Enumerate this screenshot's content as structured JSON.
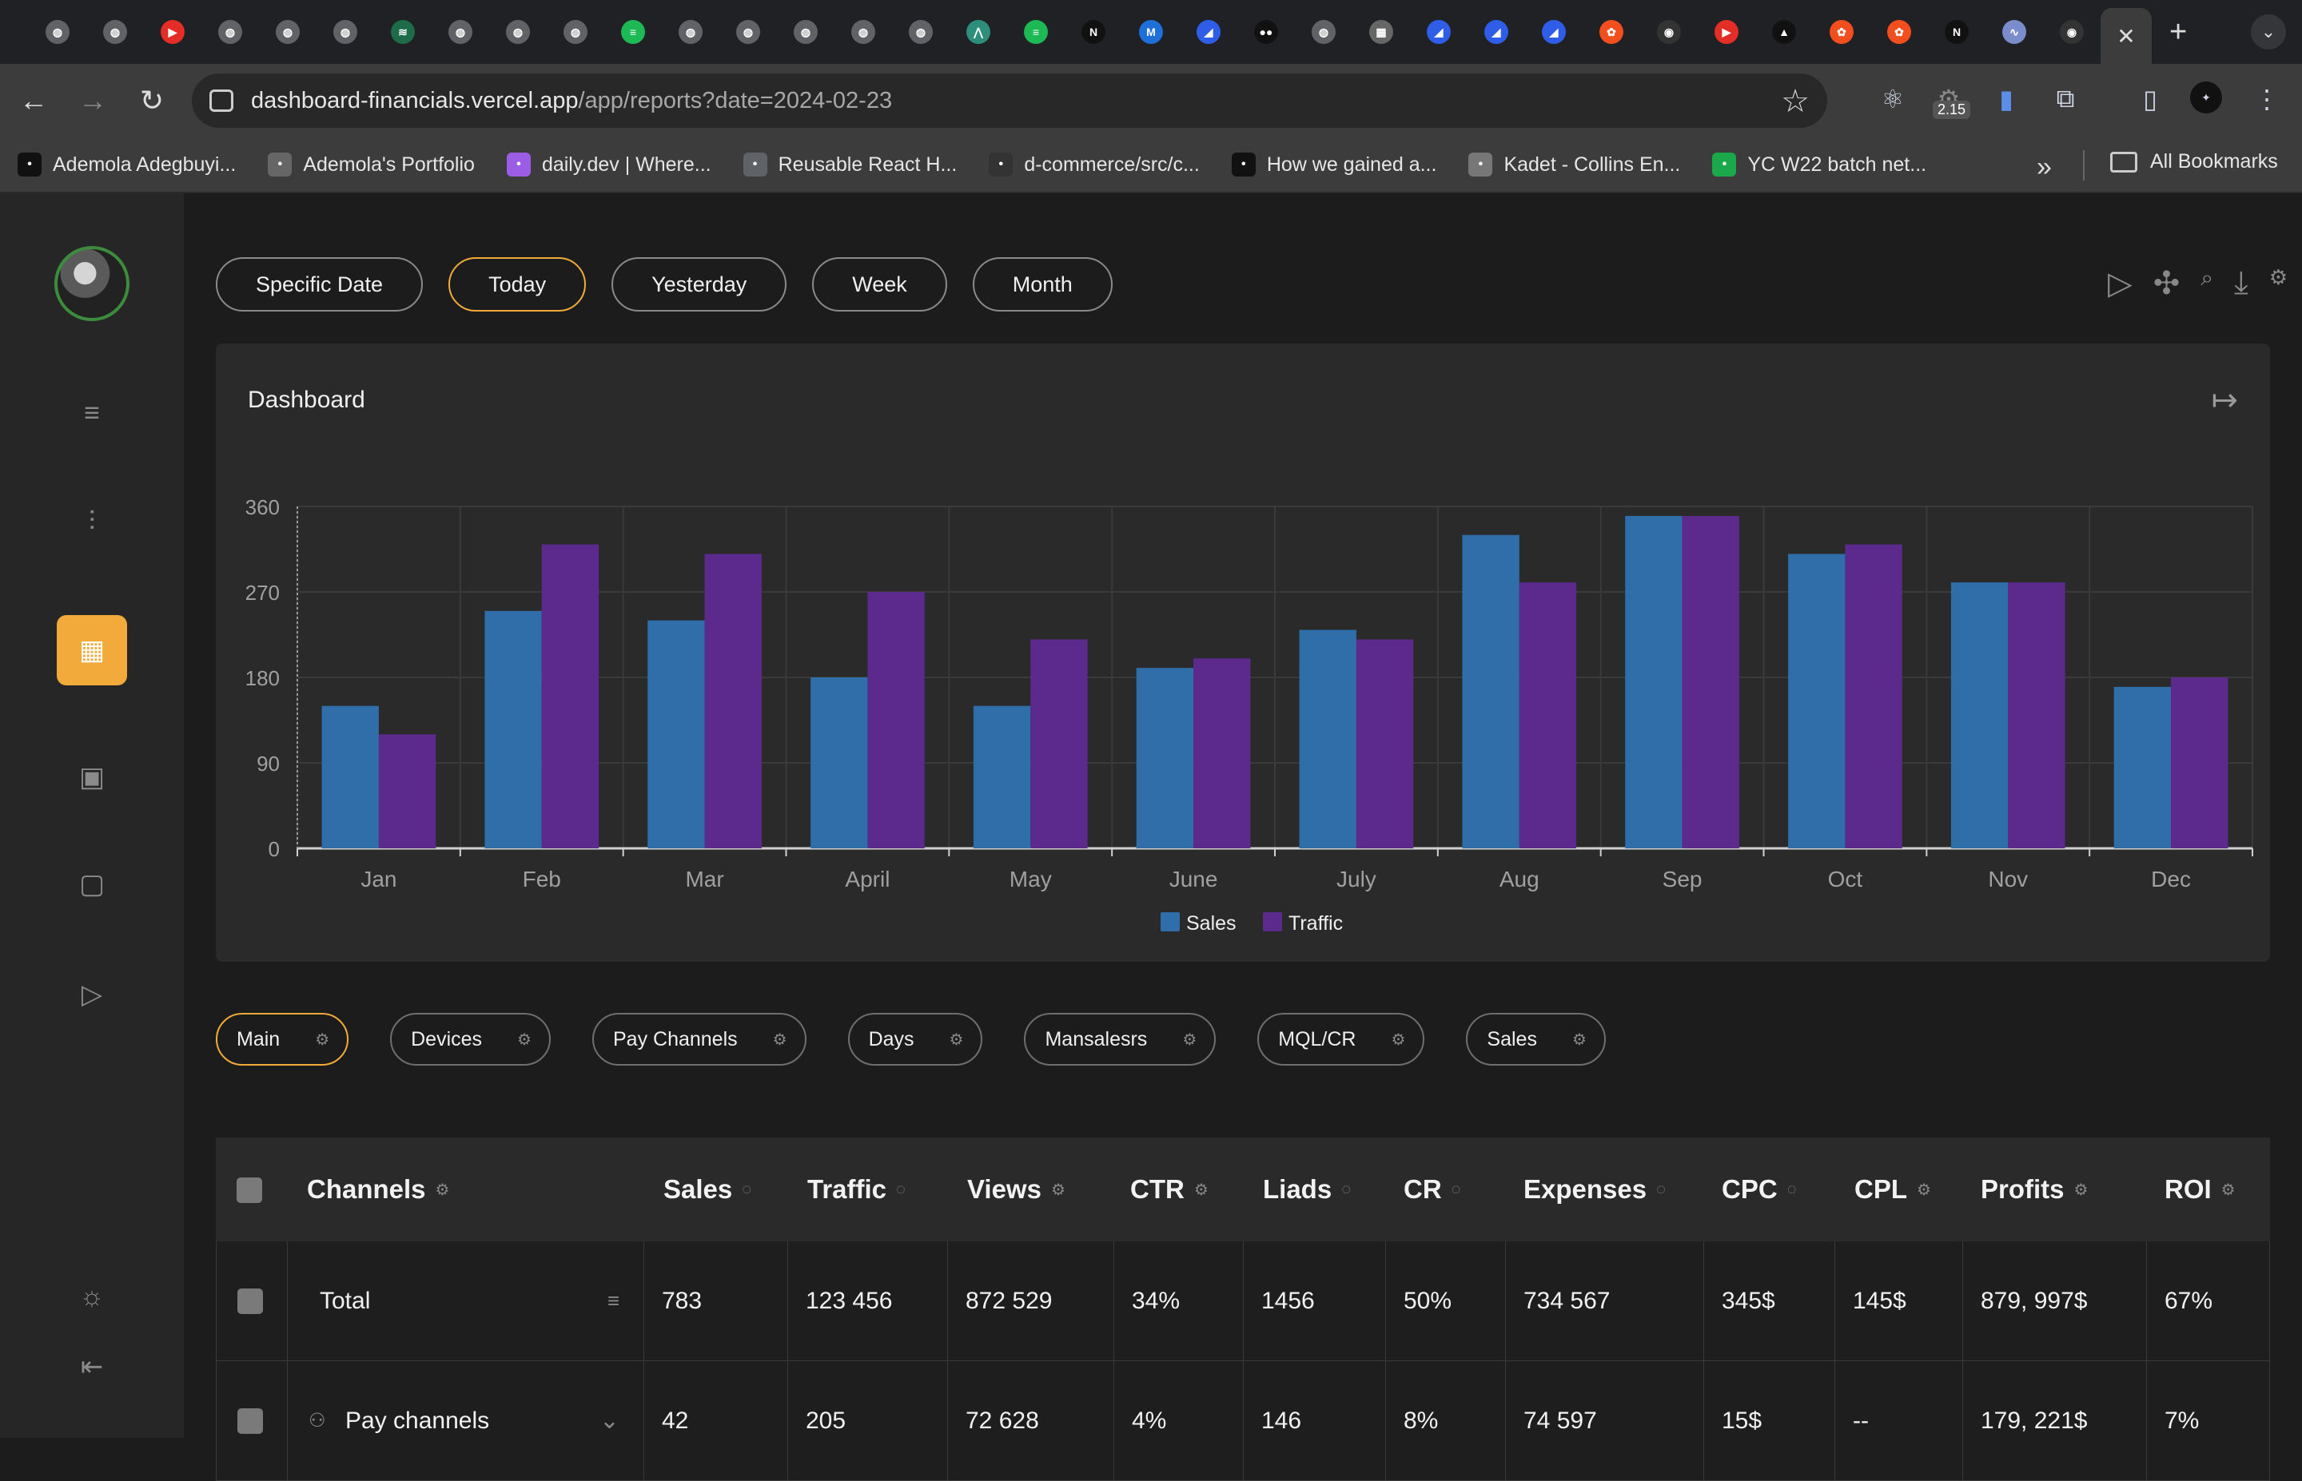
{
  "browser": {
    "tabs": [
      {
        "icon": "globe-icon",
        "color": "#5f6368"
      },
      {
        "icon": "globe-icon",
        "color": "#5f6368"
      },
      {
        "icon": "youtube-icon",
        "color": "#e52d27"
      },
      {
        "icon": "globe-icon",
        "color": "#5f6368"
      },
      {
        "icon": "globe-icon",
        "color": "#5f6368"
      },
      {
        "icon": "globe-icon",
        "color": "#5f6368"
      },
      {
        "icon": "stripes-icon",
        "color": "#1e6b4a"
      },
      {
        "icon": "globe-icon",
        "color": "#5f6368"
      },
      {
        "icon": "globe-icon",
        "color": "#5f6368"
      },
      {
        "icon": "globe-icon",
        "color": "#5f6368"
      },
      {
        "icon": "spotify-icon",
        "color": "#1db954"
      },
      {
        "icon": "globe-icon",
        "color": "#5f6368"
      },
      {
        "icon": "globe-icon",
        "color": "#5f6368"
      },
      {
        "icon": "globe-icon",
        "color": "#5f6368"
      },
      {
        "icon": "globe-icon",
        "color": "#5f6368"
      },
      {
        "icon": "globe-icon",
        "color": "#5f6368"
      },
      {
        "icon": "a-logo-icon",
        "color": "#2d8f7b"
      },
      {
        "icon": "spotify-icon",
        "color": "#1db954"
      },
      {
        "icon": "notion-icon",
        "color": "#111111"
      },
      {
        "icon": "mui-icon",
        "color": "#1e6fd9"
      },
      {
        "icon": "linear-icon",
        "color": "#2f5de8"
      },
      {
        "icon": "medium-icon",
        "color": "#111111"
      },
      {
        "icon": "globe-icon",
        "color": "#5f6368"
      },
      {
        "icon": "grid-icon",
        "color": "#666666"
      },
      {
        "icon": "linear-icon",
        "color": "#2f5de8"
      },
      {
        "icon": "linear-icon",
        "color": "#2f5de8"
      },
      {
        "icon": "linear-icon",
        "color": "#2f5de8"
      },
      {
        "icon": "figma-icon",
        "color": "#f24e1e"
      },
      {
        "icon": "github-icon",
        "color": "#333333"
      },
      {
        "icon": "youtube-icon",
        "color": "#e52d27"
      },
      {
        "icon": "triangle-icon",
        "color": "#111111"
      },
      {
        "icon": "figma-icon",
        "color": "#f24e1e"
      },
      {
        "icon": "figma-icon",
        "color": "#f24e1e"
      },
      {
        "icon": "notion-icon",
        "color": "#111111"
      },
      {
        "icon": "bird-icon",
        "color": "#7a8cc9"
      },
      {
        "icon": "github-icon",
        "color": "#333333"
      }
    ],
    "url_host": "dashboard-financials.vercel.app",
    "url_path": "/app/reports?date=2024-02-23",
    "ext_badge": "2.15",
    "bookmarks": [
      {
        "label": "Ademola Adegbuyi...",
        "icon": "medium-icon",
        "color": "#111111"
      },
      {
        "label": "Ademola's Portfolio",
        "icon": "portfolio-icon",
        "color": "#666666"
      },
      {
        "label": "daily.dev | Where...",
        "icon": "dailydev-icon",
        "color": "#9b5de5"
      },
      {
        "label": "Reusable React H...",
        "icon": "globe-icon",
        "color": "#5f6368"
      },
      {
        "label": "d-commerce/src/c...",
        "icon": "github-icon",
        "color": "#333333"
      },
      {
        "label": "How we gained a...",
        "icon": "medium-icon",
        "color": "#111111"
      },
      {
        "label": "Kadet - Collins En...",
        "icon": "person-icon",
        "color": "#777777"
      },
      {
        "label": "YC W22 batch net...",
        "icon": "techcrunch-icon",
        "color": "#1aa84b"
      }
    ],
    "all_bookmarks": "All Bookmarks"
  },
  "filters": [
    {
      "label": "Specific Date",
      "active": false
    },
    {
      "label": "Today",
      "active": true
    },
    {
      "label": "Yesterday",
      "active": false
    },
    {
      "label": "Week",
      "active": false
    },
    {
      "label": "Month",
      "active": false
    }
  ],
  "dashboard": {
    "title": "Dashboard"
  },
  "chart_data": {
    "type": "bar",
    "categories": [
      "Jan",
      "Feb",
      "Mar",
      "April",
      "May",
      "June",
      "July",
      "Aug",
      "Sep",
      "Oct",
      "Nov",
      "Dec"
    ],
    "series": [
      {
        "name": "Sales",
        "color": "#2f6ea8",
        "values": [
          150,
          250,
          240,
          180,
          150,
          190,
          230,
          330,
          350,
          310,
          280,
          170
        ]
      },
      {
        "name": "Traffic",
        "color": "#5b2a8c",
        "values": [
          120,
          320,
          310,
          270,
          220,
          200,
          220,
          280,
          350,
          320,
          280,
          180
        ]
      }
    ],
    "ylim": [
      0,
      360
    ],
    "yticks": [
      0,
      90,
      180,
      270,
      360
    ],
    "grid": true,
    "legend": "bottom-center"
  },
  "report_tabs": [
    {
      "label": "Main",
      "active": true
    },
    {
      "label": "Devices",
      "active": false
    },
    {
      "label": "Pay Channels",
      "active": false
    },
    {
      "label": "Days",
      "active": false
    },
    {
      "label": "Mansalesrs",
      "active": false
    },
    {
      "label": "MQL/CR",
      "active": false
    },
    {
      "label": "Sales",
      "active": false
    }
  ],
  "table": {
    "columns": [
      "Channels",
      "Sales",
      "Traffic",
      "Views",
      "CTR",
      "Liads",
      "CR",
      "Expenses",
      "CPC",
      "CPL",
      "Profits",
      "ROI"
    ],
    "rows": [
      {
        "channel": "Total",
        "values": [
          "783",
          "123 456",
          "872 529",
          "34%",
          "1456",
          "50%",
          "734 567",
          "345$",
          "145$",
          "879, 997$",
          "67%"
        ]
      },
      {
        "channel": "Pay channels",
        "values": [
          "42",
          "205",
          "72 628",
          "4%",
          "146",
          "8%",
          "74 597",
          "15$",
          "--",
          "179, 221$",
          "7%"
        ]
      }
    ]
  }
}
